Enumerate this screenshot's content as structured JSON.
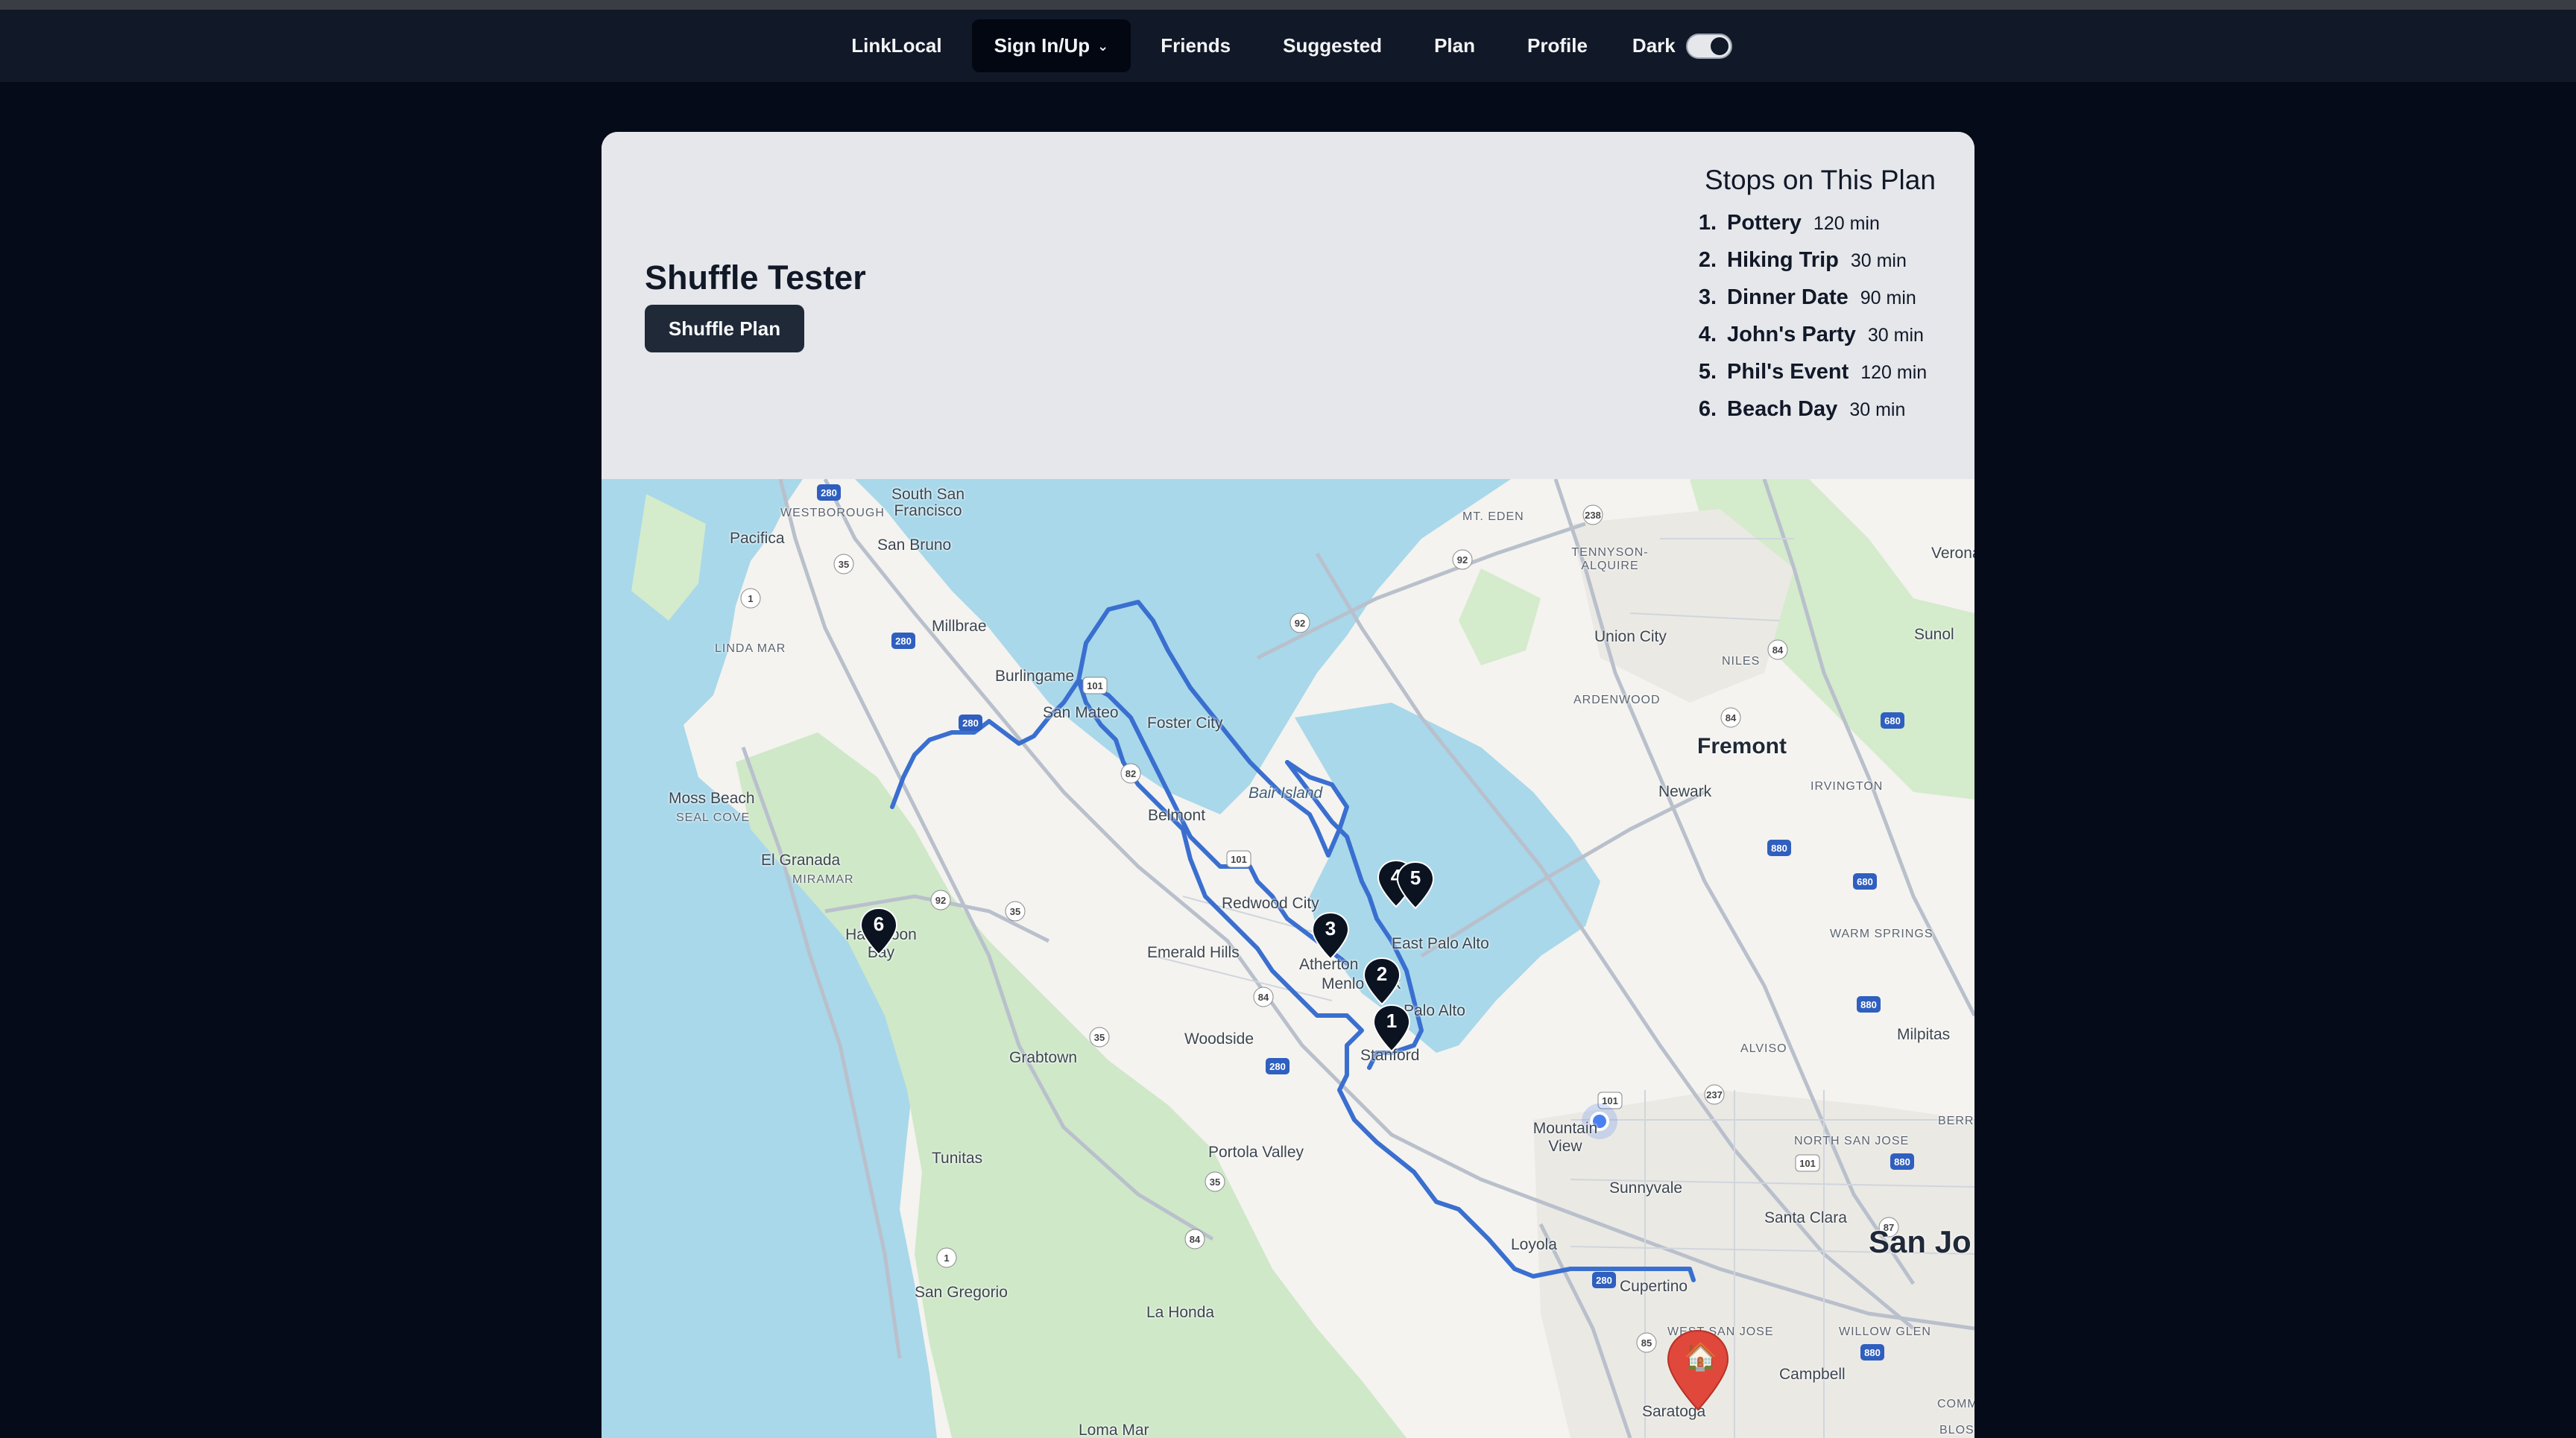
{
  "nav": {
    "brand": "LinkLocal",
    "signin": "Sign In/Up",
    "friends": "Friends",
    "suggested": "Suggested",
    "plan": "Plan",
    "profile": "Profile",
    "dark": "Dark",
    "dark_mode_on": true
  },
  "plan": {
    "title": "Shuffle Tester",
    "shuffle_label": "Shuffle Plan"
  },
  "stops": {
    "title": "Stops on This Plan",
    "items": [
      {
        "num": "1.",
        "name": "Pottery",
        "duration": "120 min"
      },
      {
        "num": "2.",
        "name": "Hiking Trip",
        "duration": "30 min"
      },
      {
        "num": "3.",
        "name": "Dinner Date",
        "duration": "90 min"
      },
      {
        "num": "4.",
        "name": "John's Party",
        "duration": "30 min"
      },
      {
        "num": "5.",
        "name": "Phil's Event",
        "duration": "120 min"
      },
      {
        "num": "6.",
        "name": "Beach Day",
        "duration": "30 min"
      }
    ]
  },
  "map": {
    "labels": {
      "pacifica": "Pacifica",
      "westborough": "WESTBOROUGH",
      "south_san_francisco": "South San Francisco",
      "san_bruno": "San Bruno",
      "millbrae": "Millbrae",
      "linda_mar": "LINDA MAR",
      "burlingame": "Burlingame",
      "san_mateo": "San Mateo",
      "foster_city": "Foster City",
      "moss_beach": "Moss Beach",
      "seal_cove": "SEAL COVE",
      "el_granada": "El Granada",
      "miramar": "MIRAMAR",
      "half_moon_bay": "Half Moon Bay",
      "belmont": "Belmont",
      "bair_island": "Bair Island",
      "redwood_city": "Redwood City",
      "emerald_hills": "Emerald Hills",
      "atherton": "Atherton",
      "menlo_park": "Menlo Park",
      "east_palo_alto": "East Palo Alto",
      "palo_alto": "Palo Alto",
      "stanford": "Stanford",
      "woodside": "Woodside",
      "grabtown": "Grabtown",
      "tunitas": "Tunitas",
      "portola_valley": "Portola Valley",
      "san_gregorio": "San Gregorio",
      "la_honda": "La Honda",
      "loma_mar": "Loma Mar",
      "mountain_view": "Mountain View",
      "sunnyvale": "Sunnyvale",
      "los_altos": "Loyola",
      "cupertino": "Cupertino",
      "west_san_jose": "WEST SAN JOSE",
      "saratoga": "Saratoga",
      "campbell": "Campbell",
      "willow_glen": "WILLOW GLEN",
      "santa_clara": "Santa Clara",
      "san_jose": "San Jo",
      "north_san_jose": "NORTH SAN JOSE",
      "berryessa": "BERRY",
      "alviso": "ALVISO",
      "milpitas": "Milpitas",
      "warm_springs": "WARM SPRINGS",
      "irvington": "IRVINGTON",
      "newark": "Newark",
      "fremont": "Fremont",
      "union_city": "Union City",
      "ardenwood": "ARDENWOOD",
      "niles": "NILES",
      "sunol": "Sunol",
      "tennyson_alquire": "TENNYSON-ALQUIRE",
      "mt_eden": "MT. EDEN",
      "verona": "Verona",
      "commu": "COMMU",
      "bloss": "BLOSS"
    },
    "shields": [
      "280",
      "35",
      "1",
      "280",
      "280",
      "101",
      "92",
      "92",
      "82",
      "101",
      "92",
      "35",
      "84",
      "35",
      "280",
      "35",
      "84",
      "1",
      "84",
      "238",
      "84",
      "880",
      "680",
      "880",
      "680",
      "880",
      "237",
      "101",
      "880",
      "87",
      "280",
      "85",
      "101"
    ],
    "markers": [
      "1",
      "2",
      "3",
      "4",
      "5",
      "6"
    ],
    "home_icon": "house-icon",
    "current_location_icon": "location-dot-icon"
  }
}
